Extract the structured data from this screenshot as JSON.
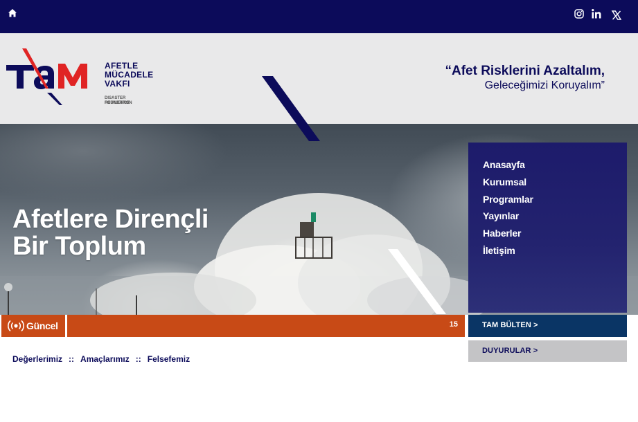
{
  "topbar": {
    "icons": [
      "home-icon",
      "instagram-icon",
      "linkedin-icon",
      "x-twitter-icon"
    ],
    "bg_color": "#0c0b5a"
  },
  "header": {
    "logo": {
      "mark": "TAM",
      "line1": "AFETLE",
      "line2": "MÜCADELE",
      "line3": "VAKFI",
      "sub1": "DISASTER RESILIENCE",
      "sub2": "FOUNDATION"
    },
    "slogan_line1": "“Afet Risklerini Azaltalım,",
    "slogan_line2": "Geleceğimizi Koruyalım”"
  },
  "hero": {
    "title_line1": "Afetlere Dirençli",
    "title_line2": "Bir Toplum"
  },
  "nav": {
    "items": [
      {
        "label": "Anasayfa"
      },
      {
        "label": "Kurumsal"
      },
      {
        "label": "Programlar"
      },
      {
        "label": "Yayınlar"
      },
      {
        "label": "Haberler"
      },
      {
        "label": "İletişim"
      }
    ]
  },
  "ticker": {
    "label": "Güncel",
    "count": "15",
    "color": "#c84a16"
  },
  "buttons": {
    "bulten": "TAM BÜLTEN   >",
    "duyurular": "DUYURULAR   >"
  },
  "sublinks": {
    "items": [
      "Değerlerimiz",
      "Amaçlarımız",
      "Felsefemiz"
    ],
    "separator": "::"
  },
  "colors": {
    "navy": "#0c0b5a",
    "red": "#e02424",
    "dark_blue_button": "#0a3565",
    "gray_button": "#c4c4c6"
  }
}
